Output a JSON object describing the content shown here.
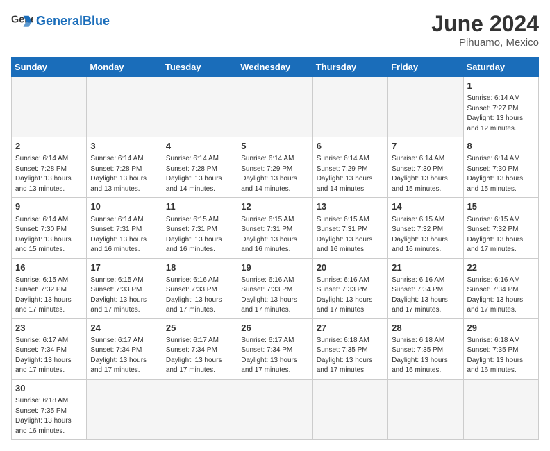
{
  "header": {
    "logo_general": "General",
    "logo_blue": "Blue",
    "month": "June 2024",
    "location": "Pihuamo, Mexico"
  },
  "weekdays": [
    "Sunday",
    "Monday",
    "Tuesday",
    "Wednesday",
    "Thursday",
    "Friday",
    "Saturday"
  ],
  "weeks": [
    [
      {
        "day": "",
        "info": ""
      },
      {
        "day": "",
        "info": ""
      },
      {
        "day": "",
        "info": ""
      },
      {
        "day": "",
        "info": ""
      },
      {
        "day": "",
        "info": ""
      },
      {
        "day": "",
        "info": ""
      },
      {
        "day": "1",
        "info": "Sunrise: 6:14 AM\nSunset: 7:27 PM\nDaylight: 13 hours\nand 12 minutes."
      }
    ],
    [
      {
        "day": "2",
        "info": "Sunrise: 6:14 AM\nSunset: 7:28 PM\nDaylight: 13 hours\nand 13 minutes."
      },
      {
        "day": "3",
        "info": "Sunrise: 6:14 AM\nSunset: 7:28 PM\nDaylight: 13 hours\nand 13 minutes."
      },
      {
        "day": "4",
        "info": "Sunrise: 6:14 AM\nSunset: 7:28 PM\nDaylight: 13 hours\nand 14 minutes."
      },
      {
        "day": "5",
        "info": "Sunrise: 6:14 AM\nSunset: 7:29 PM\nDaylight: 13 hours\nand 14 minutes."
      },
      {
        "day": "6",
        "info": "Sunrise: 6:14 AM\nSunset: 7:29 PM\nDaylight: 13 hours\nand 14 minutes."
      },
      {
        "day": "7",
        "info": "Sunrise: 6:14 AM\nSunset: 7:30 PM\nDaylight: 13 hours\nand 15 minutes."
      },
      {
        "day": "8",
        "info": "Sunrise: 6:14 AM\nSunset: 7:30 PM\nDaylight: 13 hours\nand 15 minutes."
      }
    ],
    [
      {
        "day": "9",
        "info": "Sunrise: 6:14 AM\nSunset: 7:30 PM\nDaylight: 13 hours\nand 15 minutes."
      },
      {
        "day": "10",
        "info": "Sunrise: 6:14 AM\nSunset: 7:31 PM\nDaylight: 13 hours\nand 16 minutes."
      },
      {
        "day": "11",
        "info": "Sunrise: 6:15 AM\nSunset: 7:31 PM\nDaylight: 13 hours\nand 16 minutes."
      },
      {
        "day": "12",
        "info": "Sunrise: 6:15 AM\nSunset: 7:31 PM\nDaylight: 13 hours\nand 16 minutes."
      },
      {
        "day": "13",
        "info": "Sunrise: 6:15 AM\nSunset: 7:31 PM\nDaylight: 13 hours\nand 16 minutes."
      },
      {
        "day": "14",
        "info": "Sunrise: 6:15 AM\nSunset: 7:32 PM\nDaylight: 13 hours\nand 16 minutes."
      },
      {
        "day": "15",
        "info": "Sunrise: 6:15 AM\nSunset: 7:32 PM\nDaylight: 13 hours\nand 17 minutes."
      }
    ],
    [
      {
        "day": "16",
        "info": "Sunrise: 6:15 AM\nSunset: 7:32 PM\nDaylight: 13 hours\nand 17 minutes."
      },
      {
        "day": "17",
        "info": "Sunrise: 6:15 AM\nSunset: 7:33 PM\nDaylight: 13 hours\nand 17 minutes."
      },
      {
        "day": "18",
        "info": "Sunrise: 6:16 AM\nSunset: 7:33 PM\nDaylight: 13 hours\nand 17 minutes."
      },
      {
        "day": "19",
        "info": "Sunrise: 6:16 AM\nSunset: 7:33 PM\nDaylight: 13 hours\nand 17 minutes."
      },
      {
        "day": "20",
        "info": "Sunrise: 6:16 AM\nSunset: 7:33 PM\nDaylight: 13 hours\nand 17 minutes."
      },
      {
        "day": "21",
        "info": "Sunrise: 6:16 AM\nSunset: 7:34 PM\nDaylight: 13 hours\nand 17 minutes."
      },
      {
        "day": "22",
        "info": "Sunrise: 6:16 AM\nSunset: 7:34 PM\nDaylight: 13 hours\nand 17 minutes."
      }
    ],
    [
      {
        "day": "23",
        "info": "Sunrise: 6:17 AM\nSunset: 7:34 PM\nDaylight: 13 hours\nand 17 minutes."
      },
      {
        "day": "24",
        "info": "Sunrise: 6:17 AM\nSunset: 7:34 PM\nDaylight: 13 hours\nand 17 minutes."
      },
      {
        "day": "25",
        "info": "Sunrise: 6:17 AM\nSunset: 7:34 PM\nDaylight: 13 hours\nand 17 minutes."
      },
      {
        "day": "26",
        "info": "Sunrise: 6:17 AM\nSunset: 7:34 PM\nDaylight: 13 hours\nand 17 minutes."
      },
      {
        "day": "27",
        "info": "Sunrise: 6:18 AM\nSunset: 7:35 PM\nDaylight: 13 hours\nand 17 minutes."
      },
      {
        "day": "28",
        "info": "Sunrise: 6:18 AM\nSunset: 7:35 PM\nDaylight: 13 hours\nand 16 minutes."
      },
      {
        "day": "29",
        "info": "Sunrise: 6:18 AM\nSunset: 7:35 PM\nDaylight: 13 hours\nand 16 minutes."
      }
    ],
    [
      {
        "day": "30",
        "info": "Sunrise: 6:18 AM\nSunset: 7:35 PM\nDaylight: 13 hours\nand 16 minutes."
      },
      {
        "day": "",
        "info": ""
      },
      {
        "day": "",
        "info": ""
      },
      {
        "day": "",
        "info": ""
      },
      {
        "day": "",
        "info": ""
      },
      {
        "day": "",
        "info": ""
      },
      {
        "day": "",
        "info": ""
      }
    ]
  ]
}
